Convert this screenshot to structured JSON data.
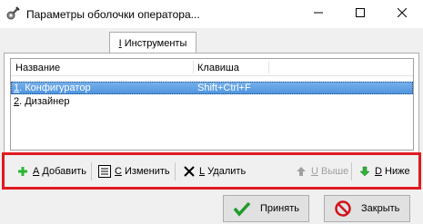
{
  "window": {
    "title": "Параметры оболочки оператора...",
    "icon": "gear-wrench-icon"
  },
  "tab": {
    "hotkey": "I",
    "label_rest": " Инструменты"
  },
  "list": {
    "columns": [
      "Название",
      "Клавиша"
    ],
    "rows": [
      {
        "num": "1",
        "name": ". Конфигуратор",
        "key": "Shift+Ctrl+F",
        "selected": true
      },
      {
        "num": "2",
        "name": ". Дизайнер",
        "key": "",
        "selected": false
      }
    ]
  },
  "toolbar": {
    "add": {
      "hotkey": "A",
      "label": " Добавить",
      "icon": "plus-icon"
    },
    "edit": {
      "hotkey": "C",
      "label": " Изменить",
      "icon": "edit-list-icon"
    },
    "delete": {
      "hotkey": "L",
      "label": " Удалить",
      "icon": "cross-icon"
    },
    "up": {
      "hotkey": "U",
      "label": " Выше",
      "icon": "arrow-up-icon",
      "disabled": true
    },
    "down": {
      "hotkey": "D",
      "label": " Ниже",
      "icon": "arrow-down-icon",
      "disabled": false
    }
  },
  "buttons": {
    "ok": "Принять",
    "close": "Закрыть"
  },
  "colors": {
    "highlight": "#e01a22",
    "selection": "#4f94df",
    "green": "#2bb534"
  }
}
